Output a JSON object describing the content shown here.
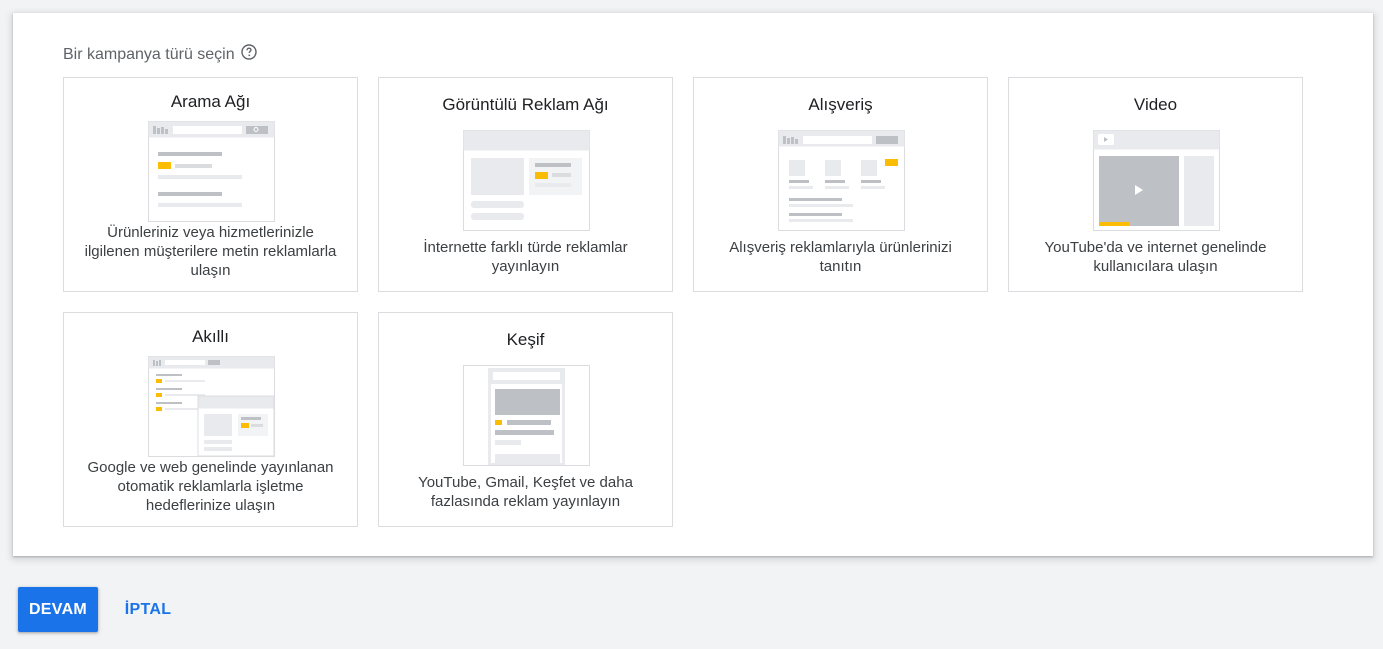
{
  "heading": "Bir kampanya türü seçin",
  "cards": [
    {
      "title": "Arama Ağı",
      "description": "Ürünleriniz veya hizmetlerinizle ilgilenen müşterilere metin reklamlarla ulaşın"
    },
    {
      "title": "Görüntülü Reklam Ağı",
      "description": "İnternette farklı türde reklamlar yayınlayın"
    },
    {
      "title": "Alışveriş",
      "description": "Alışveriş reklamlarıyla ürünlerinizi tanıtın"
    },
    {
      "title": "Video",
      "description": "YouTube'da ve internet genelinde kullanıcılara ulaşın"
    },
    {
      "title": "Akıllı",
      "description": "Google ve web genelinde yayınlanan otomatik reklamlarla işletme hedeflerinize ulaşın"
    },
    {
      "title": "Keşif",
      "description": "YouTube, Gmail, Keşfet ve daha fazlasında reklam yayınlayın"
    }
  ],
  "footer": {
    "continue_label": "DEVAM",
    "cancel_label": "İPTAL"
  },
  "colors": {
    "accent": "#1a73e8",
    "highlight": "#fbbc04",
    "border": "#dadce0"
  }
}
